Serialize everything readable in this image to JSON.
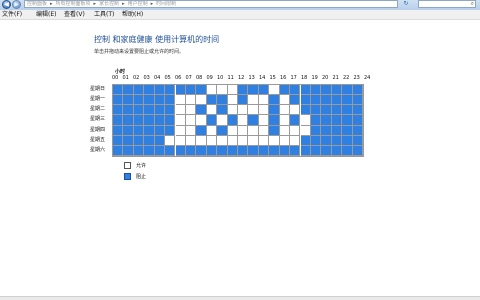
{
  "addressbar": {
    "breadcrumbs": [
      "控制面板",
      "所有控制面板项",
      "家长控制",
      "用户控制",
      "时间限制"
    ]
  },
  "menubar": {
    "items": [
      "文件(F)",
      "编辑(E)",
      "查看(V)",
      "工具(T)",
      "帮助(H)"
    ]
  },
  "page": {
    "title": "控制 和家庭健康 使用计算机的时间",
    "instruction": "单击并拖动来设置要阻止或允许的时间。"
  },
  "grid": {
    "hour_caption": "小时",
    "hours": [
      "00",
      "01",
      "02",
      "03",
      "04",
      "05",
      "06",
      "07",
      "08",
      "09",
      "10",
      "11",
      "12",
      "13",
      "14",
      "15",
      "16",
      "17",
      "18",
      "19",
      "20",
      "21",
      "22",
      "23",
      "24"
    ],
    "days": [
      "星期日",
      "星期一",
      "星期二",
      "星期三",
      "星期四",
      "星期五",
      "星期六"
    ],
    "schedule": [
      "BBBBBBBBBWWWBBBWBBBBBBBB",
      "BBBBBBWWWBBWBWWBWBBBBBBB",
      "BBBBBBWWBWBWWWWBWWBBBBBB",
      "BBBBBBWWWBWBWBWBWBWBBBBB",
      "BBBBBBWWBWBWWWWBWWWBBBBB",
      "BBBBBWWWWWWWWWWWWWBBBBBB",
      "BBBBBBBBBBBBBBBBBBBBBBBB"
    ]
  },
  "legend": {
    "allowed": "允许",
    "blocked": "阻止"
  },
  "colors": {
    "blocked": "#2f80e0",
    "allowed": "#ffffff",
    "title": "#1e4f96"
  }
}
